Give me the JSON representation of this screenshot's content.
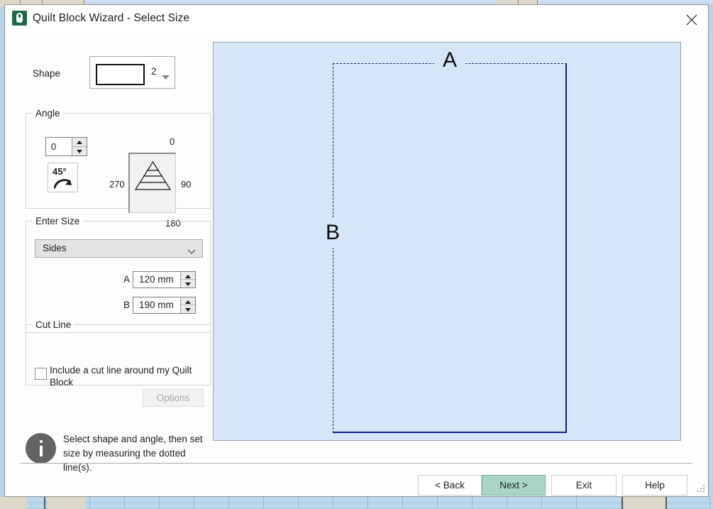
{
  "window": {
    "title": "Quilt Block Wizard - Select Size",
    "app_icon": "quilt-app-icon",
    "close_icon": "close-icon"
  },
  "shape": {
    "label": "Shape",
    "value": "2",
    "thumb_icon": "rectangle-shape-icon",
    "dropdown_icon": "chevron-down-icon"
  },
  "angle": {
    "group_title": "Angle",
    "value": "0",
    "rotate_button_label": "45°",
    "rotate_icon": "rotate-clockwise-icon",
    "preview_icon": "pyramid-orientation-icon",
    "dial": {
      "top": "0",
      "right": "90",
      "bottom": "180",
      "left": "270"
    }
  },
  "enter_size": {
    "group_title": "Enter Size",
    "mode": "Sides",
    "mode_options": [
      "Sides"
    ],
    "rows": [
      {
        "label": "A",
        "value": "120 mm"
      },
      {
        "label": "B",
        "value": "190 mm"
      }
    ]
  },
  "cut_line": {
    "group_title": "Cut Line",
    "checkbox_label": "Include a cut line around my Quilt Block",
    "checked": false,
    "options_label": "Options",
    "options_enabled": false
  },
  "info": {
    "icon": "info-icon",
    "text": "Select shape and angle, then set size by measuring the dotted line(s)."
  },
  "preview": {
    "label_a": "A",
    "label_b": "B",
    "background_color": "#d4e6f8",
    "dashed_edge_color": "#16246b",
    "solid_edge_color": "#0c1f8a"
  },
  "footer": {
    "buttons": [
      {
        "label": "< Back",
        "primary": false
      },
      {
        "label": "Next >",
        "primary": true
      },
      {
        "label": "Exit",
        "primary": false
      },
      {
        "label": "Help",
        "primary": false
      }
    ],
    "accent_color": "#a8d5c8"
  }
}
